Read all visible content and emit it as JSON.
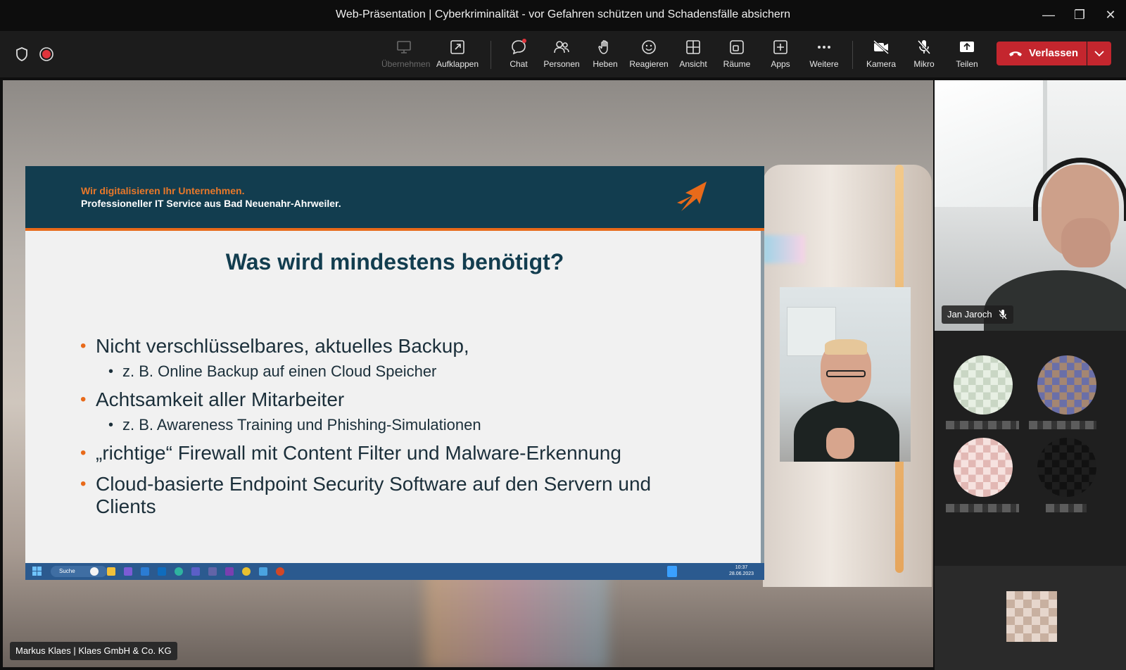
{
  "window": {
    "title": "Web-Präsentation | Cyberkriminalität - vor Gefahren schützen und Schadensfälle absichern"
  },
  "toolbar": {
    "items": [
      {
        "label": "Übernehmen",
        "icon": "screen-share-takeover-icon",
        "enabled": false
      },
      {
        "label": "Aufklappen",
        "icon": "pop-out-icon",
        "enabled": true
      },
      {
        "label": "Chat",
        "icon": "chat-icon",
        "enabled": true
      },
      {
        "label": "Personen",
        "icon": "people-icon",
        "enabled": true
      },
      {
        "label": "Heben",
        "icon": "raise-hand-icon",
        "enabled": true
      },
      {
        "label": "Reagieren",
        "icon": "smiley-icon",
        "enabled": true
      },
      {
        "label": "Ansicht",
        "icon": "grid-view-icon",
        "enabled": true
      },
      {
        "label": "Räume",
        "icon": "breakout-rooms-icon",
        "enabled": true
      },
      {
        "label": "Apps",
        "icon": "plus-square-icon",
        "enabled": true
      },
      {
        "label": "Weitere",
        "icon": "more-dots-icon",
        "enabled": true
      },
      {
        "label": "Kamera",
        "icon": "camera-off-icon",
        "enabled": true
      },
      {
        "label": "Mikro",
        "icon": "mic-off-icon",
        "enabled": true
      },
      {
        "label": "Teilen",
        "icon": "share-upload-icon",
        "enabled": true
      }
    ],
    "leave_label": "Verlassen",
    "leave_color": "#c4262e"
  },
  "slide": {
    "tagline1": "Wir digitalisieren Ihr Unternehmen.",
    "tagline2": "Professioneller IT Service aus Bad Neuenahr-Ahrweiler.",
    "title": "Was wird mindestens benötigt?",
    "bullets": [
      {
        "text": "Nicht verschlüsselbares, aktuelles Backup,",
        "sub": "z. B. Online Backup auf einen Cloud Speicher"
      },
      {
        "text": "Achtsamkeit aller Mitarbeiter",
        "sub": "z. B. Awareness Training und Phishing-Simulationen"
      },
      {
        "text": "„richtige“ Firewall mit Content Filter und Malware-Erkennung",
        "sub": null
      },
      {
        "text": "Cloud-basierte Endpoint Security Software auf den Servern und Clients",
        "sub": null
      }
    ],
    "taskbar": {
      "search": "Suche",
      "time": "10:37",
      "date": "28.06.2023"
    },
    "header_color": "#123d4f",
    "accent_color": "#e86a1a"
  },
  "presenter": {
    "label": "Markus Klaes | Klaes GmbH & Co. KG"
  },
  "participants": {
    "main": {
      "name": "Jan Jaroch",
      "muted": true
    }
  }
}
